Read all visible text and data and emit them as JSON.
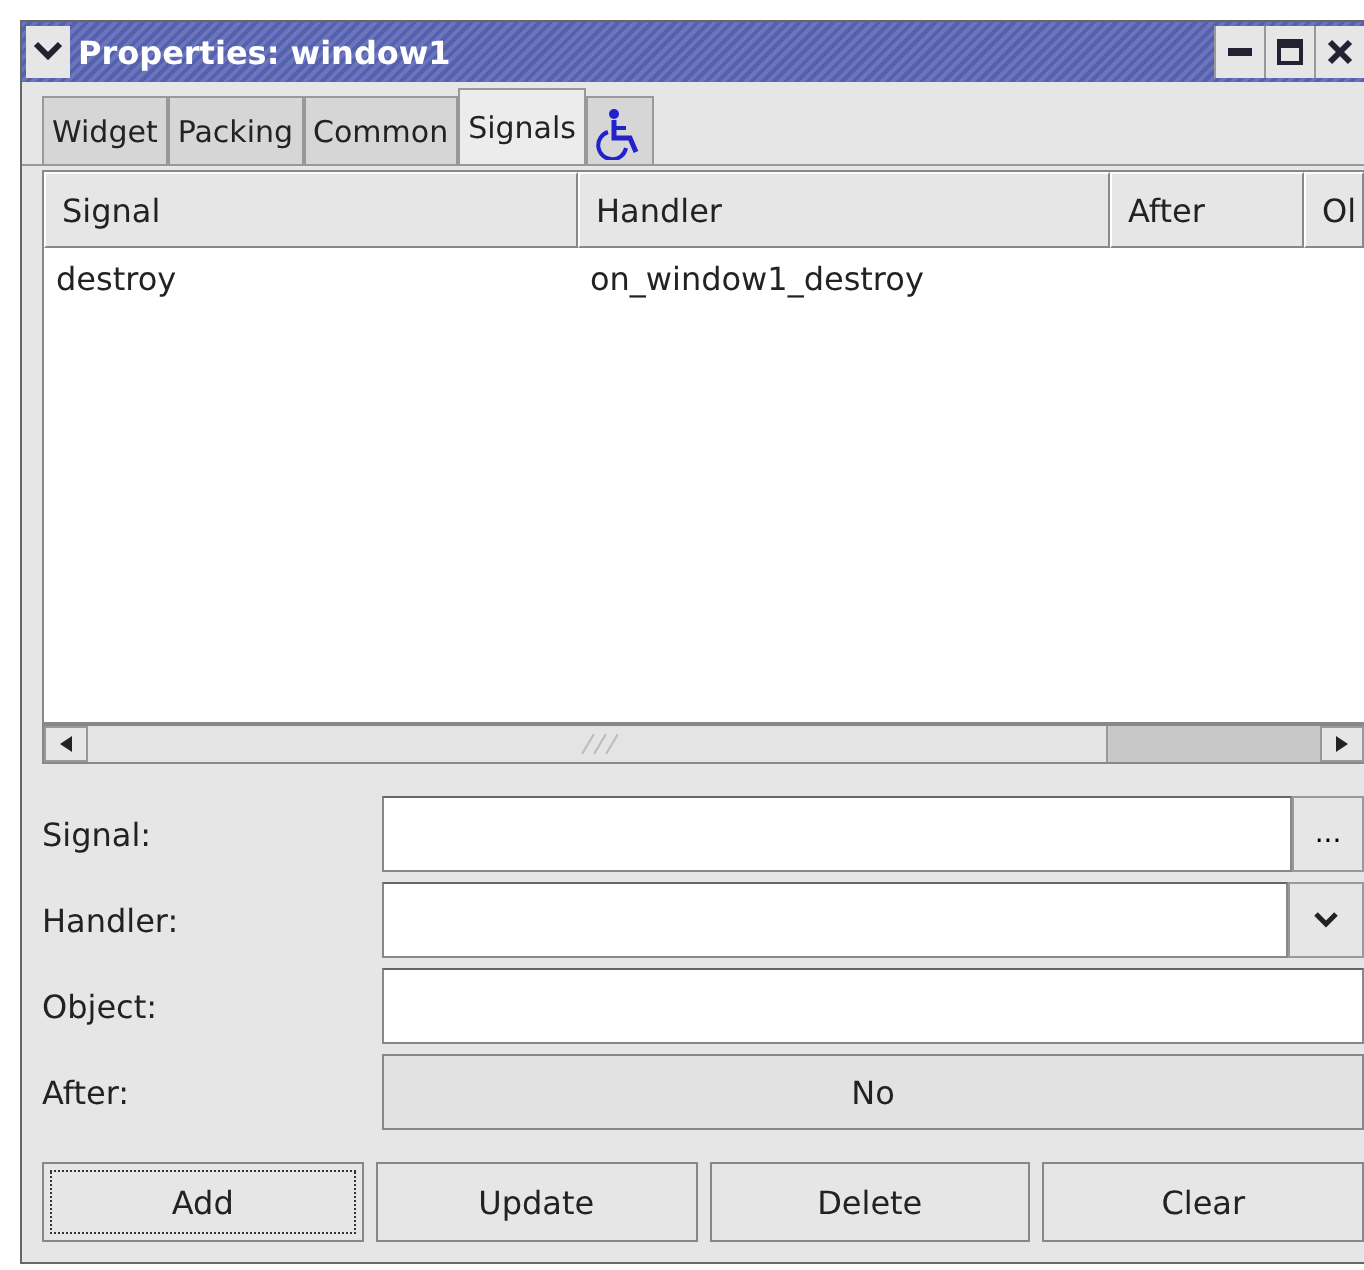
{
  "window": {
    "title": "Properties: window1"
  },
  "tabs": [
    {
      "label": "Widget",
      "selected": false
    },
    {
      "label": "Packing",
      "selected": false
    },
    {
      "label": "Common",
      "selected": false
    },
    {
      "label": "Signals",
      "selected": true
    },
    {
      "kind": "icon",
      "selected": false
    }
  ],
  "table": {
    "columns": [
      "Signal",
      "Handler",
      "After",
      "Ol"
    ],
    "rows": [
      [
        "destroy",
        "on_window1_destroy"
      ]
    ]
  },
  "form": [
    {
      "label": "Signal:",
      "kind": "entry-browse",
      "button": "..."
    },
    {
      "label": "Handler:",
      "kind": "combo"
    },
    {
      "label": "Object:",
      "kind": "entry"
    },
    {
      "label": "After:",
      "kind": "toggle",
      "value": "No"
    }
  ],
  "buttons": [
    {
      "label": "Add",
      "focused": true
    },
    {
      "label": "Update",
      "focused": false
    },
    {
      "label": "Delete",
      "focused": false
    },
    {
      "label": "Clear",
      "focused": false
    }
  ]
}
